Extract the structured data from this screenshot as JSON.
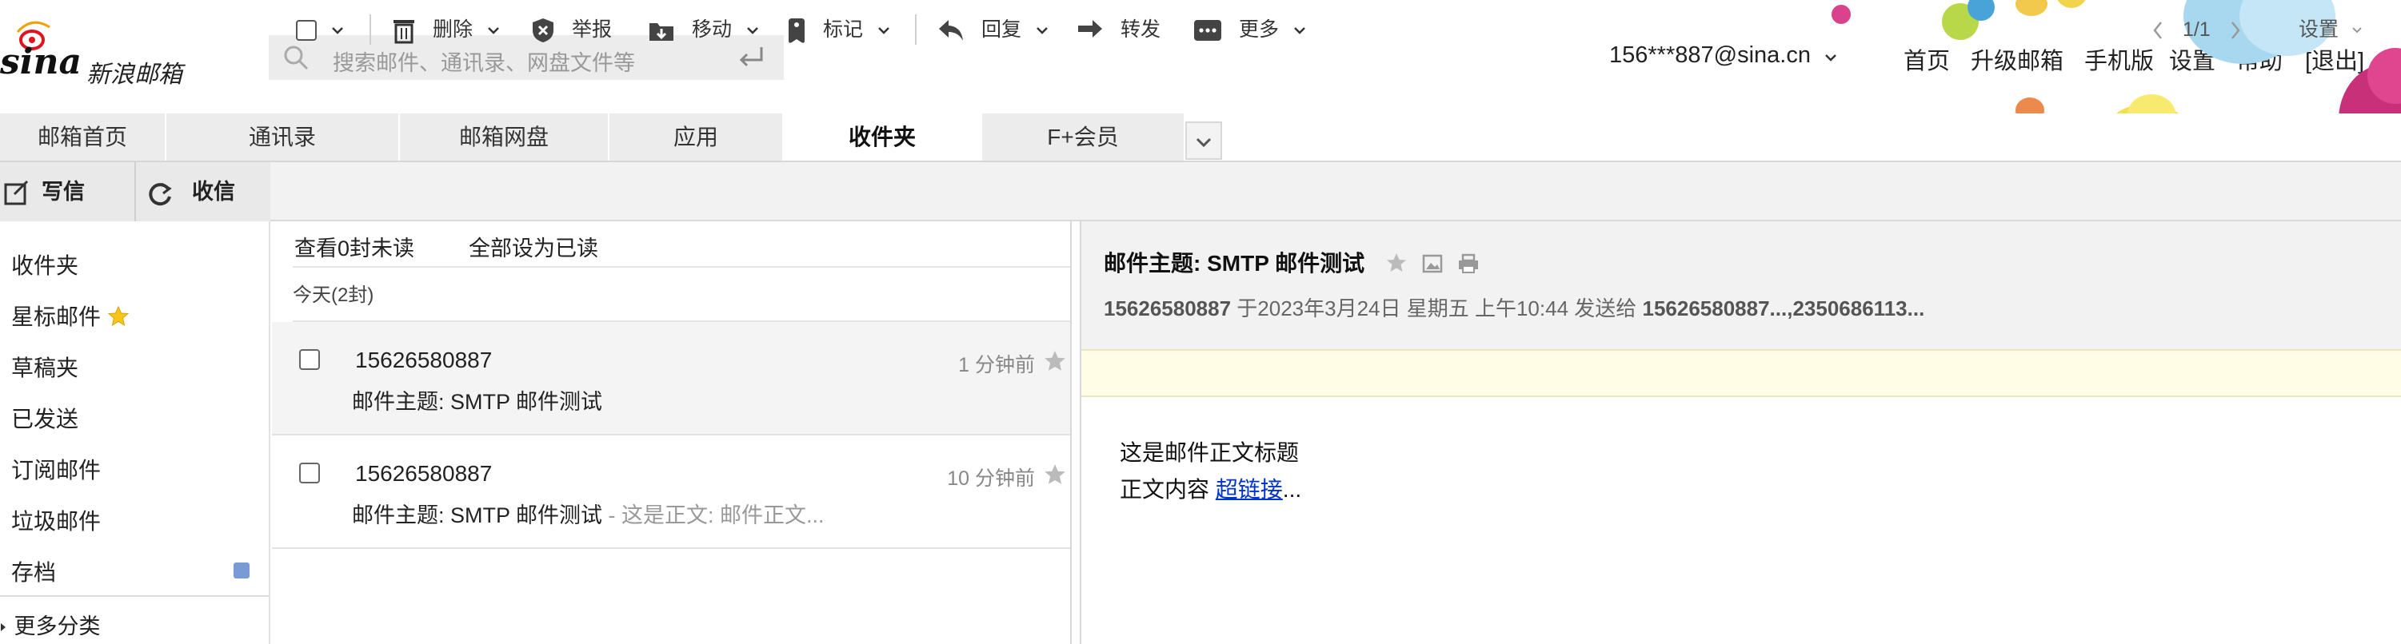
{
  "header": {
    "logo_text": "sina",
    "logo_sub": "新浪邮箱",
    "search_placeholder": "搜索邮件、通讯录、网盘文件等",
    "account": "156***887@sina.cn",
    "links": [
      "首页",
      "升级邮箱",
      "手机版",
      "设置",
      "帮助",
      "[退出]"
    ]
  },
  "tabs": [
    "邮箱首页",
    "通讯录",
    "邮箱网盘",
    "应用",
    "收件夹",
    "F+会员"
  ],
  "toolbar": {
    "write": "写信",
    "receive": "收信",
    "delete": "删除",
    "report": "举报",
    "move": "移动",
    "mark": "标记",
    "reply": "回复",
    "forward": "转发",
    "more": "更多",
    "pager": "1/1",
    "settings": "设置"
  },
  "sidebar": {
    "folders": [
      "收件夹",
      "星标邮件",
      "草稿夹",
      "已发送",
      "订阅邮件",
      "垃圾邮件",
      "存档"
    ],
    "more": "更多分类"
  },
  "list": {
    "view_unread": "查看0封未读",
    "mark_all_read": "全部设为已读",
    "group_label": "今天(2封)",
    "mails": [
      {
        "from": "15626580887",
        "subject": "邮件主题: SMTP 邮件测试",
        "preview": "",
        "time": "1 分钟前"
      },
      {
        "from": "15626580887",
        "subject": "邮件主题: SMTP 邮件测试",
        "preview": " - 这是正文: 邮件正文...",
        "time": "10 分钟前"
      }
    ]
  },
  "reader": {
    "subject": "邮件主题: SMTP 邮件测试",
    "sender": "15626580887",
    "date_text": "于2023年3月24日 星期五 上午10:44 发送给",
    "recipients": "15626580887...,2350686113...",
    "body_title": "这是邮件正文标题",
    "body_prefix": "正文内容 ",
    "body_link": "超链接",
    "body_suffix": "..."
  },
  "colors": {
    "accent_link": "#0033cc",
    "logo_red": "#e0141e",
    "note_bg": "#fffde6"
  }
}
